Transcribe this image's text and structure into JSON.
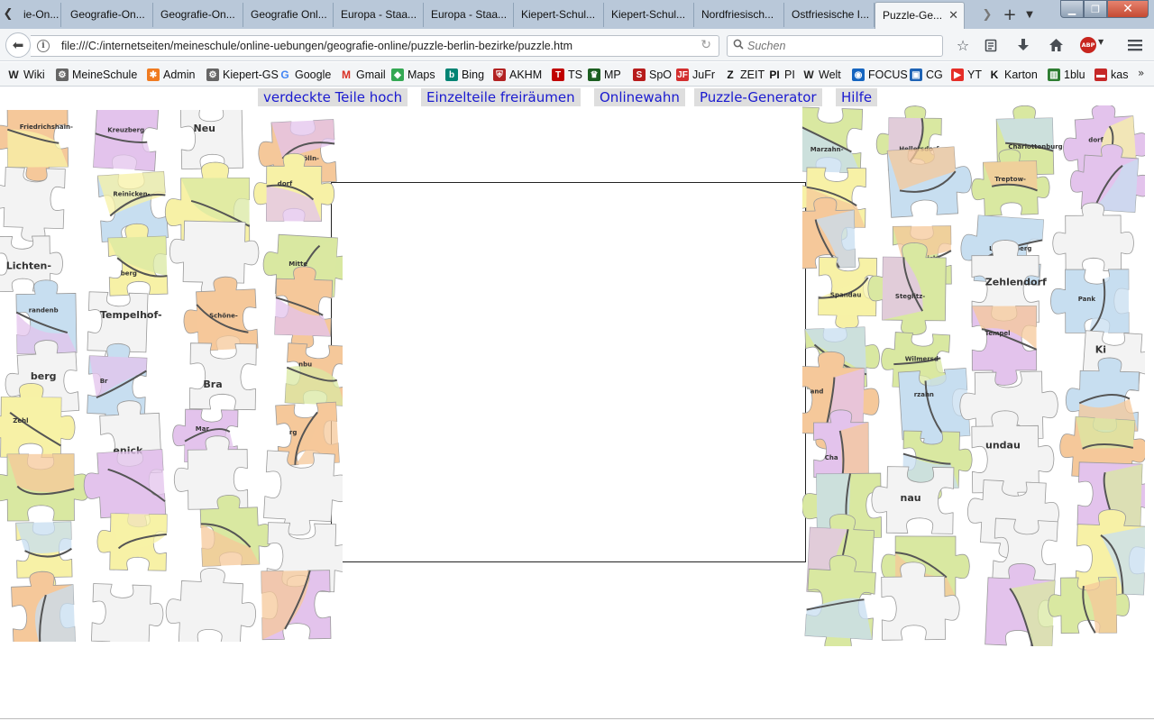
{
  "browser": {
    "tabs": [
      {
        "label": "ie-On..."
      },
      {
        "label": "Geografie-On..."
      },
      {
        "label": "Geografie-On..."
      },
      {
        "label": "Geografie Onl..."
      },
      {
        "label": "Europa - Staa..."
      },
      {
        "label": "Europa - Staa..."
      },
      {
        "label": "Kiepert-Schul..."
      },
      {
        "label": "Kiepert-Schul..."
      },
      {
        "label": "Nordfriesisch..."
      },
      {
        "label": "Ostfriesische I..."
      },
      {
        "label": "Puzzle-Ge..."
      }
    ],
    "url": "file:///C:/internetseiten/meineschule/online-uebungen/geografie-online/puzzle-berlin-bezirke/puzzle.htm",
    "search_placeholder": "Suchen",
    "abp_label": "ABP",
    "bookmarks": [
      {
        "label": "Wiki",
        "icon": "W"
      },
      {
        "label": "MeineSchule",
        "icon": "gear"
      },
      {
        "label": "Admin",
        "icon": "joomla"
      },
      {
        "label": "Kiepert-GS",
        "icon": "gear"
      },
      {
        "label": "Google",
        "icon": "G"
      },
      {
        "label": "Gmail",
        "icon": "M"
      },
      {
        "label": "Maps",
        "icon": "maps"
      },
      {
        "label": "Bing",
        "icon": "b"
      },
      {
        "label": "AKHM",
        "icon": "shield"
      },
      {
        "label": "TS",
        "icon": "T"
      },
      {
        "label": "MP",
        "icon": "crown"
      },
      {
        "label": "SpO",
        "icon": "S"
      },
      {
        "label": "JuFr",
        "icon": "JF"
      },
      {
        "label": "ZEIT",
        "icon": "Z"
      },
      {
        "label": "PI",
        "icon": "PI"
      },
      {
        "label": "Welt",
        "icon": "W"
      },
      {
        "label": "FOCUS",
        "icon": "globe"
      },
      {
        "label": "CG",
        "icon": "box"
      },
      {
        "label": "YT",
        "icon": "play"
      },
      {
        "label": "Karton",
        "icon": "K"
      },
      {
        "label": "1blu",
        "icon": "chart"
      },
      {
        "label": "kas",
        "icon": "car"
      }
    ],
    "icon_colors": {
      "W": "#222222",
      "gear": "#666666",
      "joomla": "#f07b21",
      "G": "#4285f4",
      "M": "#d93025",
      "maps": "#34a853",
      "b": "#008373",
      "shield": "#b22222",
      "T": "#c00000",
      "crown": "#1b5e20",
      "S": "#b71c1c",
      "JF": "#d32f2f",
      "Z": "#111111",
      "PI": "#111111",
      "globe": "#1565c0",
      "box": "#1e63b5",
      "play": "#e52d27",
      "K": "#111111",
      "chart": "#2e7d32",
      "car": "#c62828"
    }
  },
  "page": {
    "menu": [
      {
        "label": "verdeckte Teile hoch"
      },
      {
        "label": "Einzelteile freiräumen"
      },
      {
        "label": "Onlinewahn"
      },
      {
        "label": "Puzzle-Generator"
      },
      {
        "label": "Hilfe"
      }
    ],
    "piece_labels": {
      "left": [
        "Friedrichshain-",
        "Kreuzberg",
        "Neu",
        "Neukölln-",
        "Reinicken-",
        "dorf",
        "Lichten-",
        "berg",
        "Mitte",
        "randenb",
        "Tempelhof-",
        "Schöne-",
        "berg",
        "Br",
        "Bra",
        "nbu",
        "Zehl",
        "enick",
        "Mar",
        "rg"
      ],
      "right": [
        "Marzahn-",
        "Hellersdorf",
        "Charlottenburg-",
        "dorf",
        "Treptow-",
        "Köpenick",
        "Lichtenberg",
        "Spandau",
        "Steglitz-",
        "Zehlendorf",
        "Pank",
        "Spa",
        "Wilmersd",
        "Tempel",
        "Ki",
        "and",
        "rzahn",
        "Cha",
        "undau",
        "nau"
      ]
    },
    "palette": {
      "yellow": "#f7f1a6",
      "pink": "#e3c3ec",
      "orange": "#f5c89a",
      "green": "#d9e8a1",
      "blue": "#c7def0",
      "grey": "#f3f3f3",
      "border": "#555555"
    }
  }
}
